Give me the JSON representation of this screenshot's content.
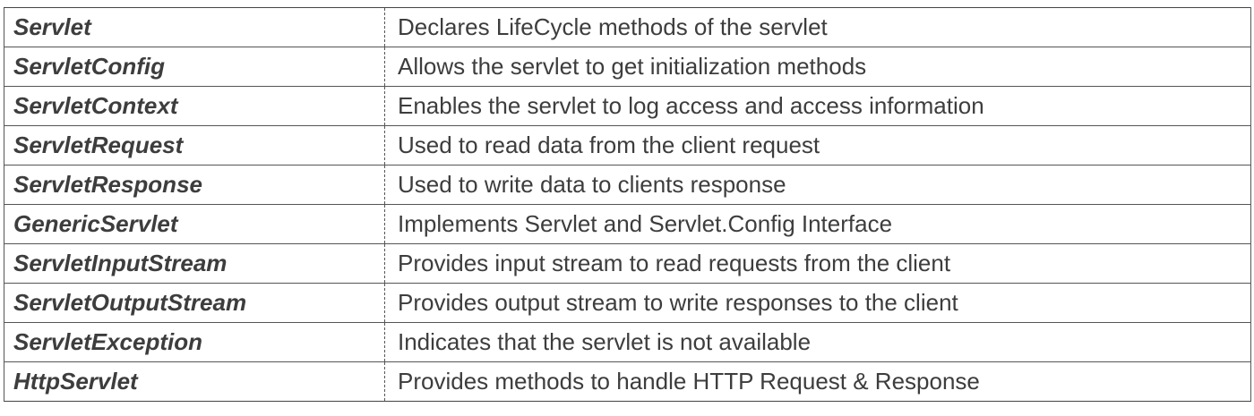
{
  "table": {
    "rows": [
      {
        "name": "Servlet",
        "description": "Declares LifeCycle methods of the servlet"
      },
      {
        "name": "ServletConfig",
        "description": "Allows the servlet to get initialization methods"
      },
      {
        "name": "ServletContext",
        "description": "Enables the servlet to log access and access information"
      },
      {
        "name": "ServletRequest",
        "description": "Used to read data from the client request"
      },
      {
        "name": "ServletResponse",
        "description": "Used to write data to clients response"
      },
      {
        "name": "GenericServlet",
        "description": "Implements Servlet and Servlet.Config Interface"
      },
      {
        "name": "ServletInputStream",
        "description": "Provides input stream to read requests from the client"
      },
      {
        "name": "ServletOutputStream",
        "description": "Provides output stream to write responses to the client"
      },
      {
        "name": "ServletException",
        "description": "Indicates that the servlet is not available"
      },
      {
        "name": "HttpServlet",
        "description": "Provides methods to handle HTTP Request & Response"
      }
    ]
  }
}
